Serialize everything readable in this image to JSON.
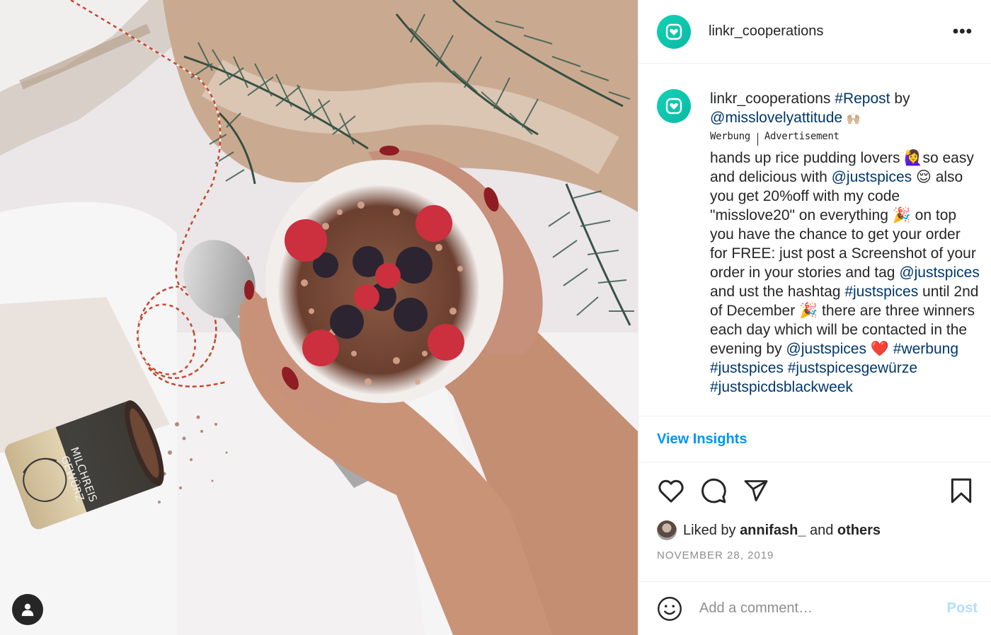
{
  "post": {
    "username": "linkr_cooperations",
    "more_label": "•••"
  },
  "caption": {
    "username": "linkr_cooperations",
    "repost_tag": "#Repost",
    "by_word": "by",
    "original_author": "@misslovelyattitude",
    "author_emoji": "🙌🏼",
    "ad_label_de": "Werbung",
    "ad_label_en": "Advertisement",
    "text_part1": "hands up rice pudding lovers 🙋‍♀️so easy and delicious with ",
    "mention1": "@justspices",
    "text_part2": " 😌 also you get 20%off with my code \"misslove20\" on everything 🎉 on top you have the chance to get your order for FREE: just post a Screenshot of your order in your stories and tag ",
    "mention2": "@justspices",
    "text_part3": " and ust the hashtag ",
    "hashtag1": "#justspices",
    "text_part4": " until 2nd of December 🎉 there are three winners each day which will be contacted in the evening by ",
    "mention3": "@justspices",
    "text_part5": " ❤️ ",
    "hashtag2": "#werbung",
    "hashtag3": "#justspices",
    "hashtag4": "#justspicesgewürze",
    "hashtag5": "#justspicdsblackweek"
  },
  "insights": {
    "label": "View Insights"
  },
  "actions": {
    "like_icon": "heart-icon",
    "comment_icon": "comment-icon",
    "share_icon": "paper-plane-icon",
    "save_icon": "bookmark-icon"
  },
  "likes": {
    "prefix": "Liked by",
    "user": "annifash_",
    "middle": "and",
    "others": "others"
  },
  "date": "NOVEMBER 28, 2019",
  "comment": {
    "placeholder": "Add a comment…",
    "post_label": "Post"
  },
  "photo": {
    "tin_label_line1": "MILCHREIS",
    "tin_label_line2": "GEWÜRZ"
  },
  "colors": {
    "brand_teal": "#11c9b0",
    "link_blue": "#00376b",
    "insights_blue": "#0095f6",
    "post_disabled": "#b2dffc"
  }
}
